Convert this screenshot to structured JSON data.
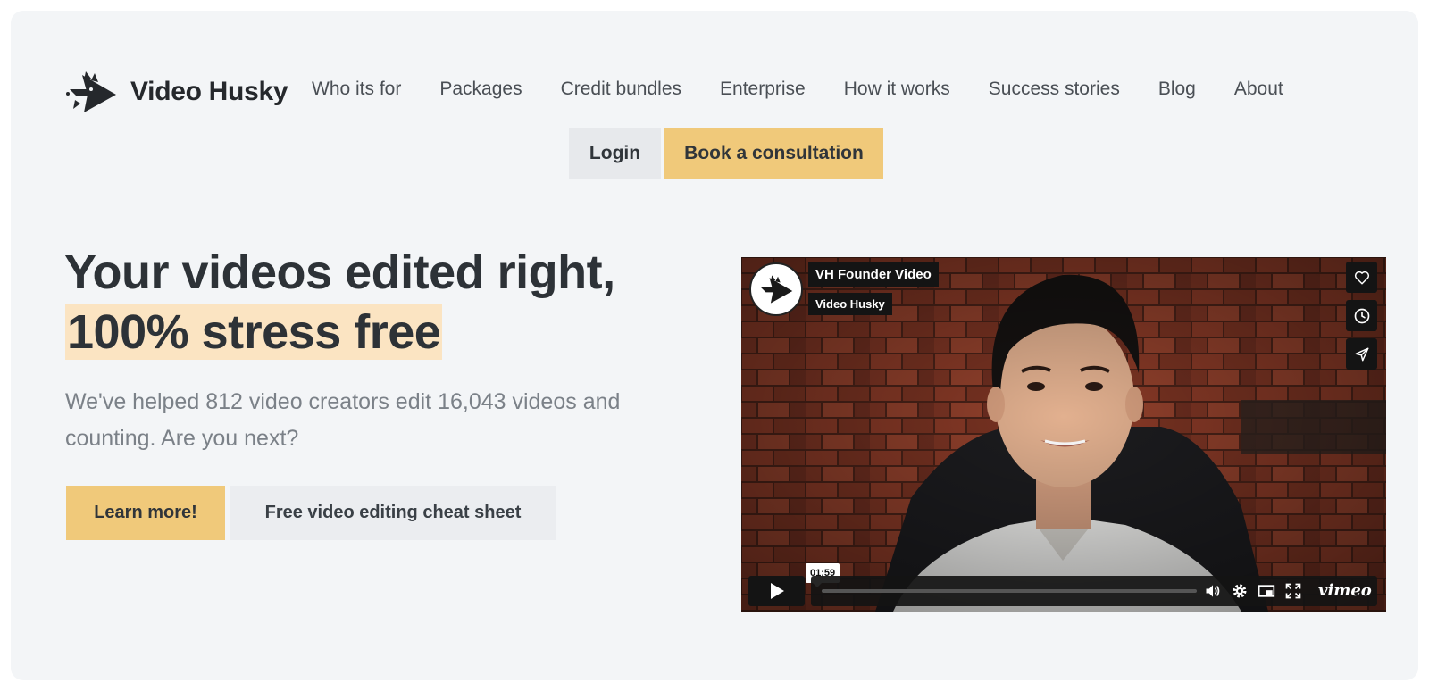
{
  "brand": {
    "name": "Video Husky"
  },
  "nav": {
    "items": [
      {
        "label": "Who its for"
      },
      {
        "label": "Packages"
      },
      {
        "label": "Credit bundles"
      },
      {
        "label": "Enterprise"
      },
      {
        "label": "How it works"
      },
      {
        "label": "Success stories"
      },
      {
        "label": "Blog"
      },
      {
        "label": "About"
      }
    ],
    "login_label": "Login",
    "consult_label": "Book a consultation"
  },
  "hero": {
    "title_line1": "Your videos edited right,",
    "title_line2": "100% stress free",
    "subtitle": "We've helped 812 video creators edit 16,043 videos and counting. Are you next?",
    "learn_more_label": "Learn more!",
    "cheat_sheet_label": "Free video editing cheat sheet"
  },
  "video": {
    "title": "VH Founder Video",
    "byline": "Video Husky",
    "duration": "01:59",
    "progress_fraction": 0,
    "provider": "vimeo"
  },
  "colors": {
    "accent": "#f0c97a",
    "highlight": "#fbe4c2",
    "background": "#f3f5f7",
    "text_dark": "#2d3237",
    "text_muted": "#7b8188"
  },
  "icons": {
    "logo": "husky-logo-icon",
    "like": "heart-icon",
    "watch_later": "clock-icon",
    "share": "paper-plane-icon",
    "play": "play-icon",
    "volume": "volume-icon",
    "settings": "gear-icon",
    "pip": "picture-in-picture-icon",
    "fullscreen": "fullscreen-icon"
  }
}
